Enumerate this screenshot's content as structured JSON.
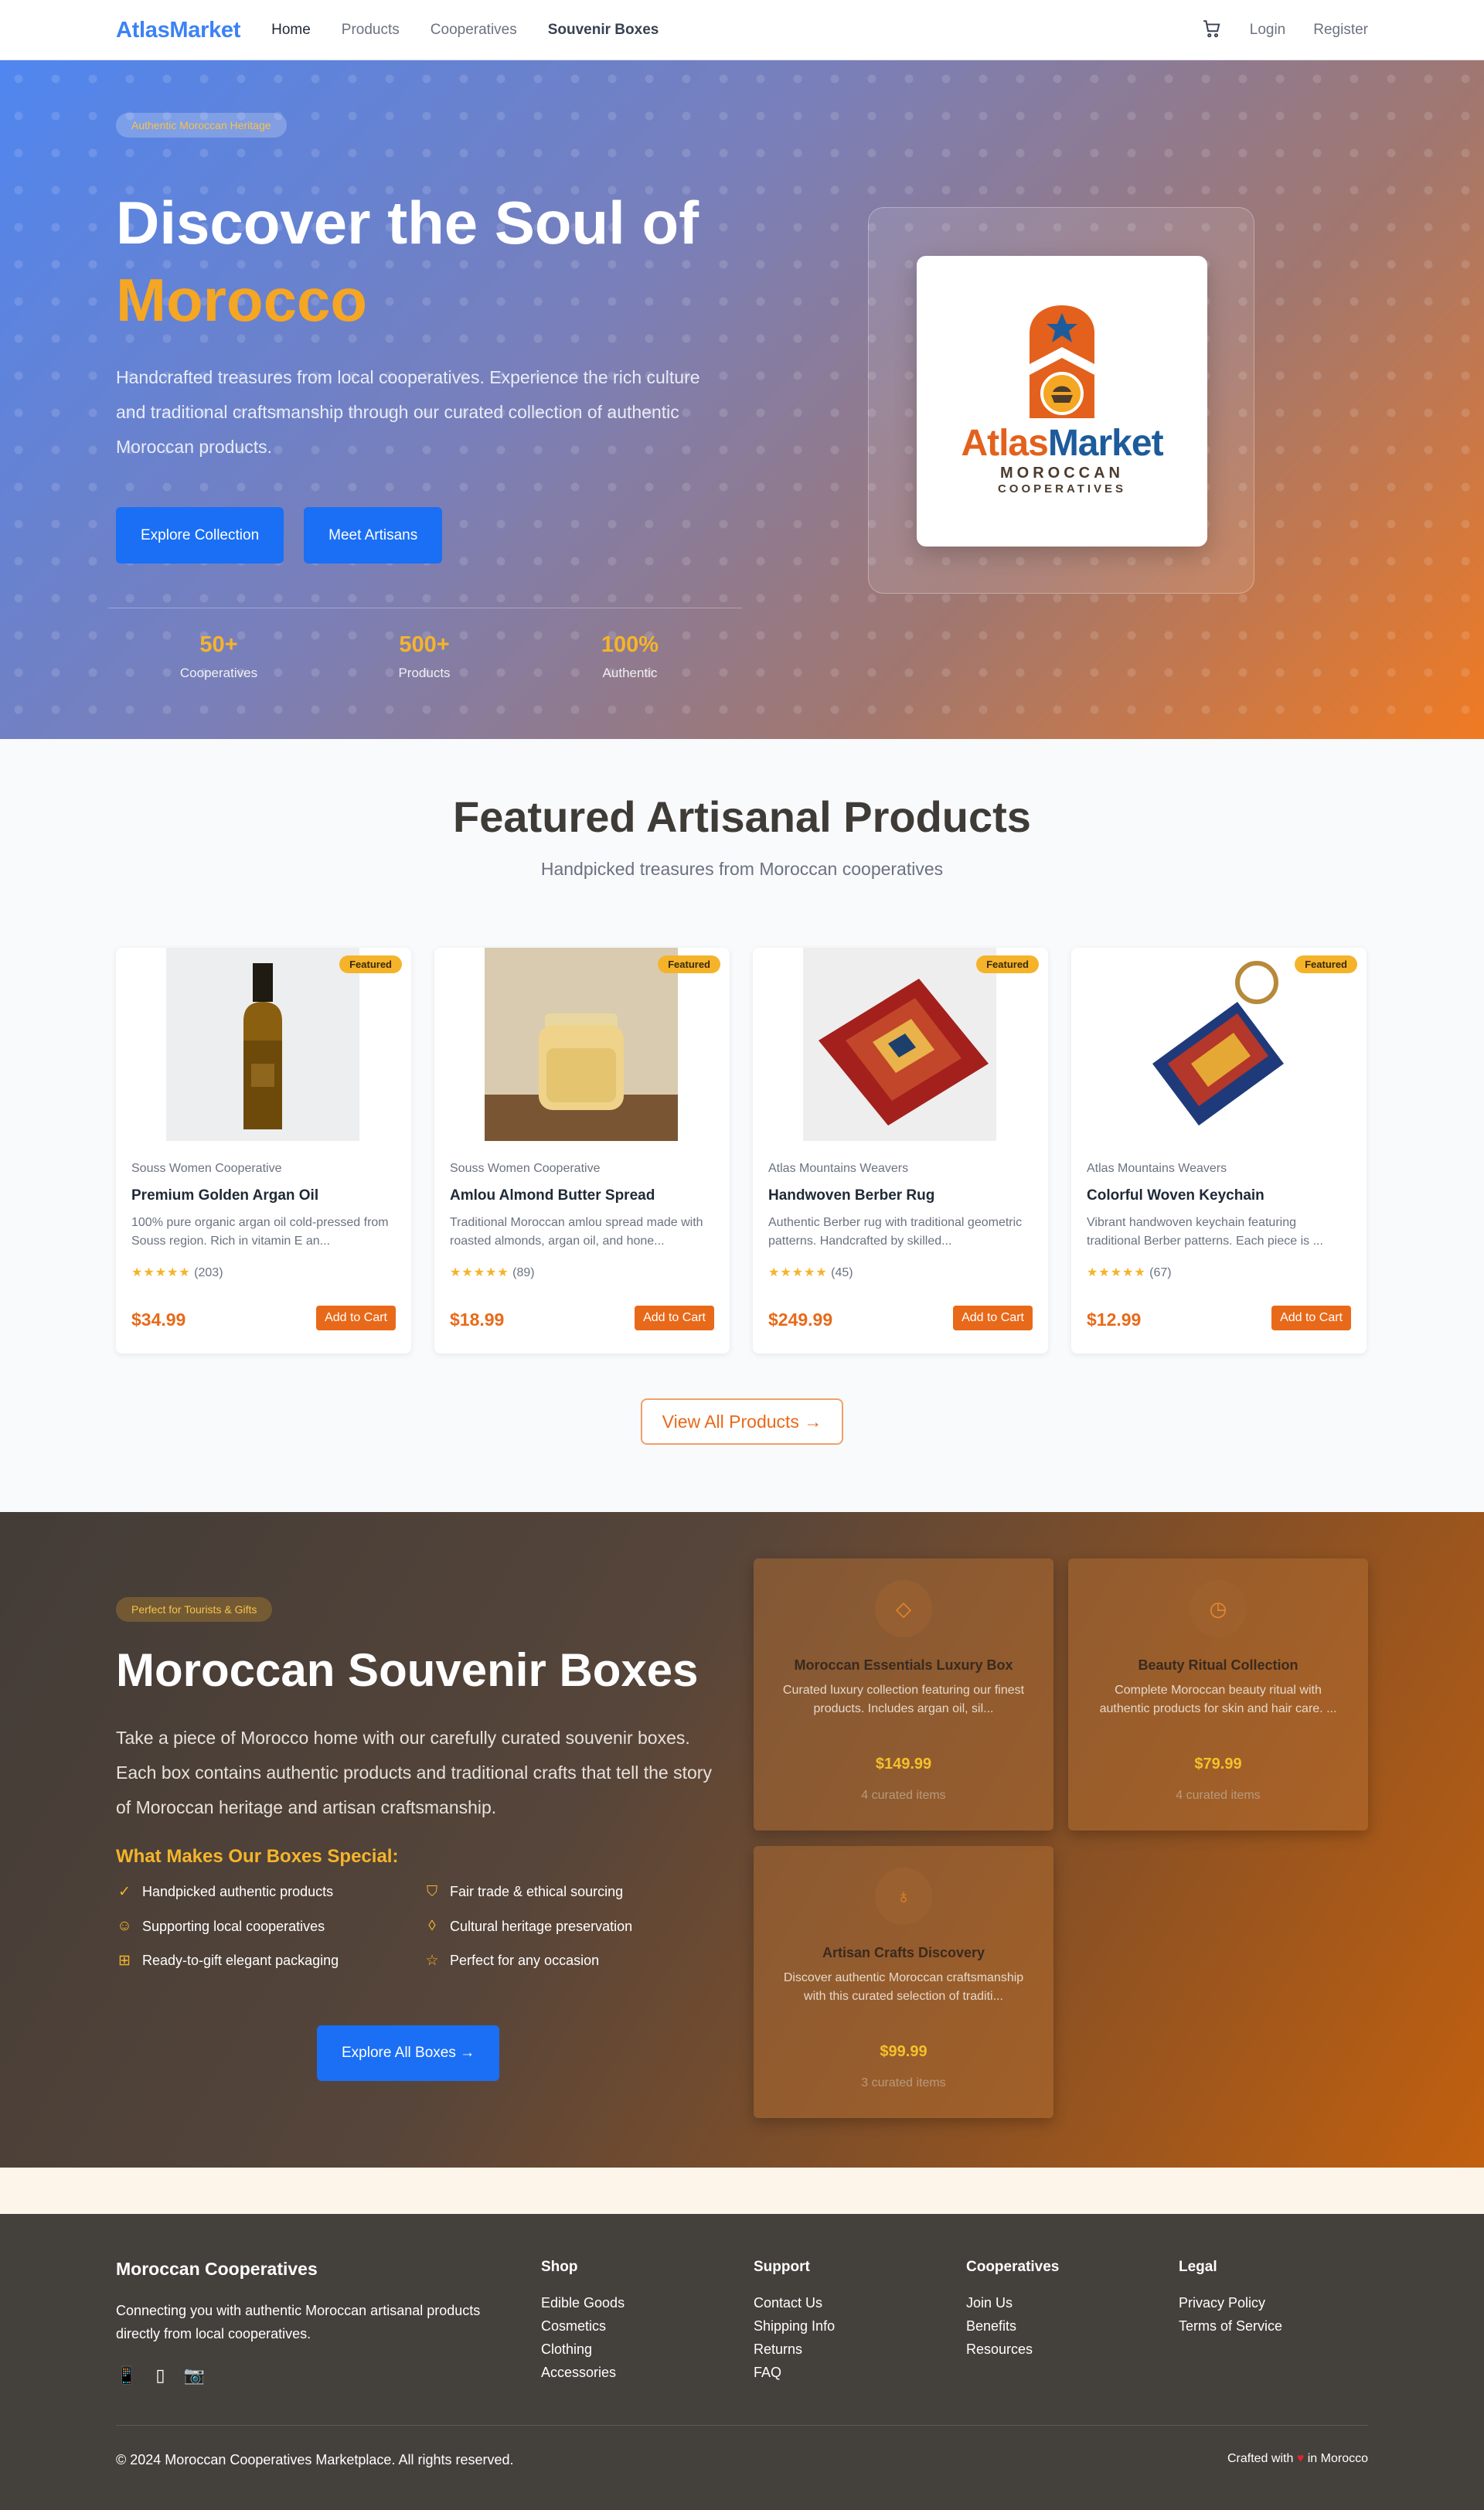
{
  "nav": {
    "brand": "AtlasMarket",
    "links": [
      "Home",
      "Products",
      "Cooperatives",
      "Souvenir Boxes"
    ],
    "login": "Login",
    "register": "Register"
  },
  "hero": {
    "pill": "Authentic Moroccan Heritage",
    "title1": "Discover the Soul of",
    "title2": "Morocco",
    "lead": "Handcrafted treasures from local cooperatives. Experience the rich culture and traditional craftsmanship through our curated collection of authentic Moroccan products.",
    "btn1": "Explore Collection",
    "btn2": "Meet Artisans",
    "stats": [
      {
        "num": "50+",
        "label": "Cooperatives"
      },
      {
        "num": "500+",
        "label": "Products"
      },
      {
        "num": "100%",
        "label": "Authentic"
      }
    ],
    "logo": {
      "name_a": "Atlas",
      "name_b": "Market",
      "sub1": "MOROCCAN",
      "sub2": "COOPERATIVES"
    }
  },
  "featured": {
    "title": "Featured Artisanal Products",
    "subtitle": "Handpicked treasures from Moroccan cooperatives",
    "badge": "Featured",
    "add": "Add to Cart",
    "products": [
      {
        "coop": "Souss Women Cooperative",
        "name": "Premium Golden Argan Oil",
        "desc": "100% pure organic argan oil cold-pressed from Souss region. Rich in vitamin E an...",
        "stars": "★★★★★",
        "reviews": "(203)",
        "price": "$34.99"
      },
      {
        "coop": "Souss Women Cooperative",
        "name": "Amlou Almond Butter Spread",
        "desc": "Traditional Moroccan amlou spread made with roasted almonds, argan oil, and hone...",
        "stars": "★★★★★",
        "reviews": "(89)",
        "price": "$18.99"
      },
      {
        "coop": "Atlas Mountains Weavers",
        "name": "Handwoven Berber Rug",
        "desc": "Authentic Berber rug with traditional geometric patterns. Handcrafted by skilled...",
        "stars": "★★★★★",
        "reviews": "(45)",
        "price": "$249.99"
      },
      {
        "coop": "Atlas Mountains Weavers",
        "name": "Colorful Woven Keychain",
        "desc": "Vibrant handwoven keychain featuring traditional Berber patterns. Each piece is ...",
        "stars": "★★★★★",
        "reviews": "(67)",
        "price": "$12.99"
      }
    ],
    "view_all": "View All Products →"
  },
  "souvenir": {
    "pill": "Perfect for Tourists & Gifts",
    "title": "Moroccan Souvenir Boxes",
    "lead": "Take a piece of Morocco home with our carefully curated souvenir boxes. Each box contains authentic products and traditional crafts that tell the story of Moroccan heritage and artisan craftsmanship.",
    "special": "What Makes Our Boxes Special:",
    "features": [
      "Handpicked authentic products",
      "Fair trade & ethical sourcing",
      "Supporting local cooperatives",
      "Cultural heritage preservation",
      "Ready-to-gift elegant packaging",
      "Perfect for any occasion"
    ],
    "btn": "Explore All Boxes →",
    "boxes": [
      {
        "title": "Moroccan Essentials Luxury Box",
        "desc": "Curated luxury collection featuring our finest products. Includes argan oil, sil...",
        "price": "$149.99",
        "items": "4 curated items"
      },
      {
        "title": "Beauty Ritual Collection",
        "desc": "Complete Moroccan beauty ritual with authentic products for skin and hair care. ...",
        "price": "$79.99",
        "items": "4 curated items"
      },
      {
        "title": "Artisan Crafts Discovery",
        "desc": "Discover authentic Moroccan craftsmanship with this curated selection of traditi...",
        "price": "$99.99",
        "items": "3 curated items"
      }
    ]
  },
  "footer": {
    "brand": "Moroccan Cooperatives",
    "desc": "Connecting you with authentic Moroccan artisanal products directly from local cooperatives.",
    "cols": [
      {
        "title": "Shop",
        "links": [
          "Edible Goods",
          "Cosmetics",
          "Clothing",
          "Accessories"
        ]
      },
      {
        "title": "Support",
        "links": [
          "Contact Us",
          "Shipping Info",
          "Returns",
          "FAQ"
        ]
      },
      {
        "title": "Cooperatives",
        "links": [
          "Join Us",
          "Benefits",
          "Resources"
        ]
      },
      {
        "title": "Legal",
        "links": [
          "Privacy Policy",
          "Terms of Service"
        ]
      }
    ],
    "copyright": "© 2024 Moroccan Cooperatives Marketplace. All rights reserved.",
    "crafted_a": "Crafted with",
    "crafted_b": "in Morocco"
  }
}
